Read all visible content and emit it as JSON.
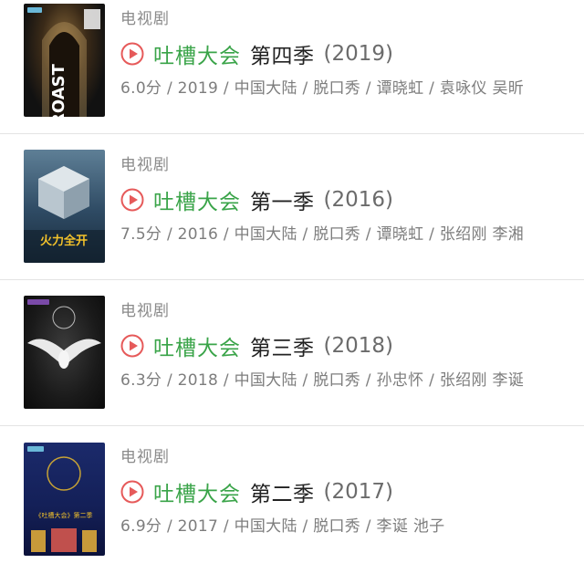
{
  "colors": {
    "link_green": "#3aa449",
    "category_gray": "#8a8a8a",
    "title_dark": "#222222",
    "play_icon_red": "#e65a5a"
  },
  "items": [
    {
      "category": "电视剧",
      "title_link": "吐槽大会",
      "title_season": "第四季",
      "title_year": "(2019)",
      "meta": "6.0分 / 2019 / 中国大陆 / 脱口秀 / 谭晓虹 / 袁咏仪 吴昕",
      "poster_icon": "poster-roast-image"
    },
    {
      "category": "电视剧",
      "title_link": "吐槽大会",
      "title_season": "第一季",
      "title_year": "(2016)",
      "meta": "7.5分 / 2016 / 中国大陆 / 脱口秀 / 谭晓虹 / 张绍刚 李湘",
      "poster_icon": "poster-cube-image",
      "poster_text": "火力全开"
    },
    {
      "category": "电视剧",
      "title_link": "吐槽大会",
      "title_season": "第三季",
      "title_year": "(2018)",
      "meta": "6.3分 / 2018 / 中国大陆 / 脱口秀 / 孙忠怀 / 张绍刚 李诞",
      "poster_icon": "poster-dove-image"
    },
    {
      "category": "电视剧",
      "title_link": "吐槽大会",
      "title_season": "第二季",
      "title_year": "(2017)",
      "meta": "6.9分 / 2017 / 中国大陆 / 脱口秀 / 李诞 池子",
      "poster_icon": "poster-stage-image",
      "poster_text": "《吐槽大会》第二季"
    }
  ]
}
